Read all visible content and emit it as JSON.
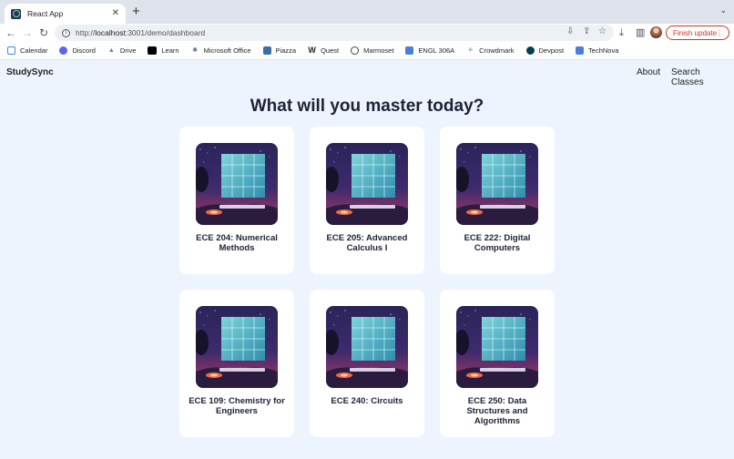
{
  "browser": {
    "tab_title": "React App",
    "url_prefix": "http://",
    "url_host": "localhost",
    "url_path": ":3001/demo/dashboard",
    "finish_update_label": "Finish update",
    "bookmarks": [
      {
        "label": "Calendar",
        "icon": "calendar-icon",
        "color": "#4285f4"
      },
      {
        "label": "Discord",
        "icon": "discord-icon",
        "color": "#5865f2"
      },
      {
        "label": "Drive",
        "icon": "google-drive-icon",
        "color": "#34a853"
      },
      {
        "label": "Learn",
        "icon": "learn-icon",
        "color": "#000000"
      },
      {
        "label": "Microsoft Office",
        "icon": "microsoft-office-icon",
        "color": "#5b6b9e"
      },
      {
        "label": "Piazza",
        "icon": "piazza-icon",
        "color": "#3a6ea5"
      },
      {
        "label": "Quest",
        "icon": "quest-icon",
        "color": "#000000"
      },
      {
        "label": "Marmoset",
        "icon": "marmoset-icon",
        "color": "#444444"
      },
      {
        "label": "ENGL 306A",
        "icon": "document-icon",
        "color": "#4a7ed8"
      },
      {
        "label": "Crowdmark",
        "icon": "crowdmark-icon",
        "color": "#6aa84f"
      },
      {
        "label": "Devpost",
        "icon": "devpost-icon",
        "color": "#003e54"
      },
      {
        "label": "TechNova",
        "icon": "document-icon",
        "color": "#4a7ed8"
      }
    ]
  },
  "app": {
    "brand": "StudySync",
    "nav": {
      "about": "About",
      "search": "Search Classes"
    },
    "hero_title": "What will you master today?",
    "courses": [
      {
        "title": "ECE 204: Numerical Methods"
      },
      {
        "title": "ECE 205: Advanced Calculus I"
      },
      {
        "title": "ECE 222: Digital Computers"
      },
      {
        "title": "ECE 109: Chemistry for Engineers"
      },
      {
        "title": "ECE 240: Circuits"
      },
      {
        "title": "ECE 250: Data Structures and Algorithms"
      }
    ]
  },
  "colors": {
    "page_bg": "#eef4fe",
    "accent_update": "#d93025",
    "heading": "#1e2235"
  }
}
